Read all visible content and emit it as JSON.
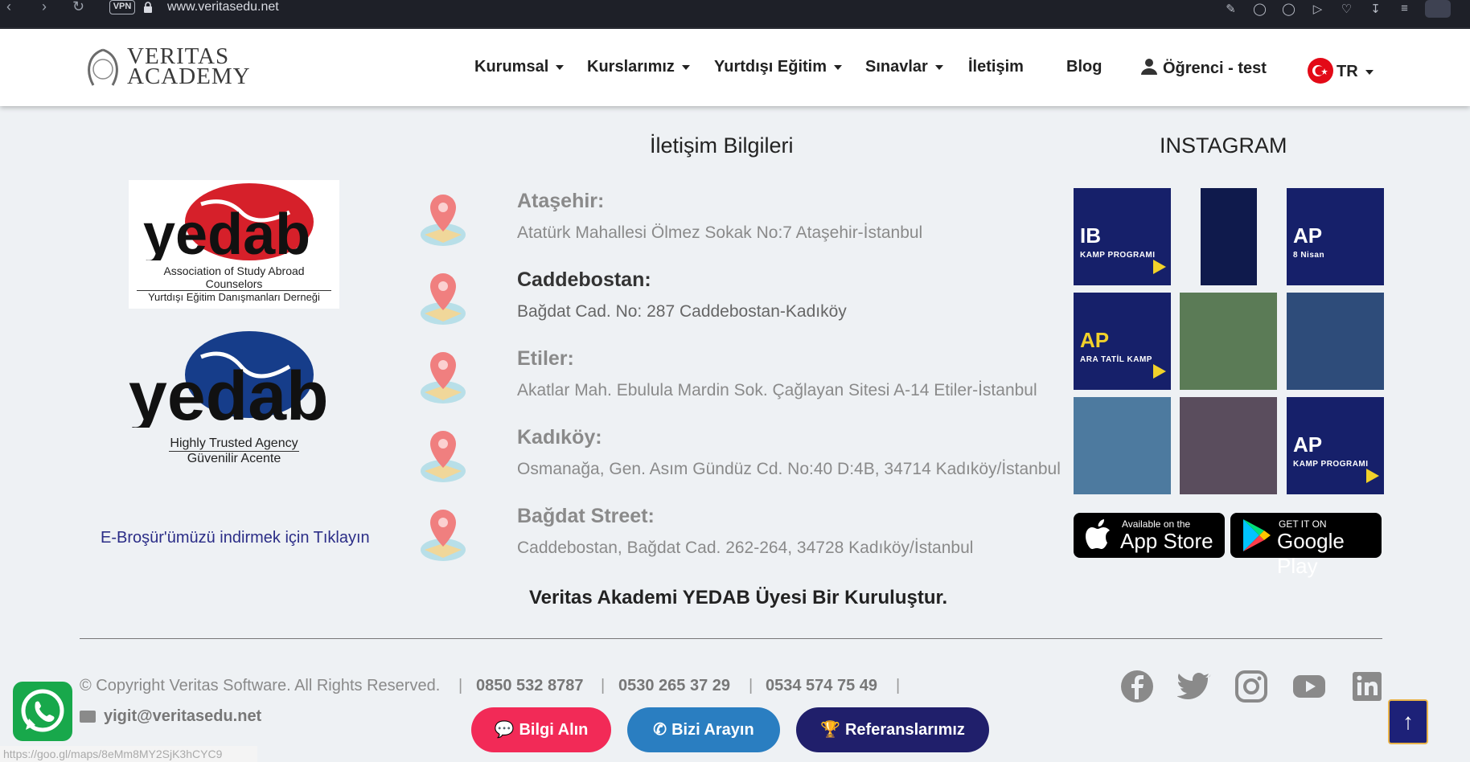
{
  "browser": {
    "url": "www.veritasedu.net",
    "vpn_label": "VPN"
  },
  "header": {
    "logo_line1": "VERITAS",
    "logo_line2": "ACADEMY",
    "nav": [
      {
        "label": "Kurumsal",
        "dropdown": true
      },
      {
        "label": "Kurslarımız",
        "dropdown": true
      },
      {
        "label": "Yurtdışı Eğitim",
        "dropdown": true
      },
      {
        "label": "Sınavlar",
        "dropdown": true
      },
      {
        "label": "İletişim",
        "dropdown": false
      },
      {
        "label": "Blog",
        "dropdown": false
      }
    ],
    "user_label": "Öğrenci - test",
    "language": "TR"
  },
  "yedab": {
    "badge1": {
      "word": "yedab",
      "line1": "Association of Study Abroad Counselors",
      "line2": "Yurtdışı Eğitim Danışmanları Derneği",
      "color": "#d6202a"
    },
    "badge2": {
      "word": "yedab",
      "line1": "Highly Trusted Agency",
      "line2": "Güvenilir Acente",
      "color": "#163d8a"
    },
    "brochure_link": "E-Broşür'ümüzü indirmek için Tıklayın"
  },
  "contact": {
    "title": "İletişim Bilgileri",
    "locations": [
      {
        "name": "Ataşehir:",
        "address": "Atatürk Mahallesi Ölmez Sokak No:7 Ataşehir-İstanbul"
      },
      {
        "name": "Caddebostan:",
        "address": "Bağdat Cad. No: 287 Caddebostan-Kadıköy"
      },
      {
        "name": "Etiler:",
        "address": "Akatlar Mah. Ebulula Mardin Sok. Çağlayan Sitesi A-14 Etiler-İstanbul"
      },
      {
        "name": "Kadıköy:",
        "address": "Osmanağa, Gen. Asım Gündüz Cd. No:40 D:4B, 34714 Kadıköy/İstanbul"
      },
      {
        "name": "Bağdat Street:",
        "address": "Caddebostan, Bağdat Cad. 262-264, 34728 Kadıköy/İstanbul"
      }
    ],
    "member_note": "Veritas Akademi YEDAB Üyesi Bir Kuruluştur."
  },
  "instagram": {
    "title": "INSTAGRAM",
    "tiles": [
      {
        "big": "IB",
        "small": "KAMP PROGRAMI",
        "style": "navy"
      },
      {
        "big": "",
        "small": "",
        "style": "dark"
      },
      {
        "big": "AP",
        "small": "8 Nisan",
        "style": "navy"
      },
      {
        "big": "AP",
        "small": "ARA TATİL KAMP",
        "style": "navy"
      },
      {
        "big": "",
        "small": "",
        "style": "photo"
      },
      {
        "big": "",
        "small": "",
        "style": "photo"
      },
      {
        "big": "",
        "small": "",
        "style": "photo"
      },
      {
        "big": "",
        "small": "",
        "style": "photo"
      },
      {
        "big": "AP",
        "small": "KAMP PROGRAMI",
        "style": "navy"
      }
    ],
    "app_store": {
      "top": "Available on the",
      "bottom": "App Store"
    },
    "google_play": {
      "top": "GET IT ON",
      "bottom": "Google Play"
    }
  },
  "footer": {
    "copyright": "© Copyright Veritas Software. All Rights Reserved.",
    "phones": [
      "0850 532 8787",
      "0530 265 37 29",
      "0534 574 75 49"
    ],
    "email": "yigit@veritasedu.net",
    "buttons": [
      {
        "label": "Bilgi Alın",
        "color": "#f22a57"
      },
      {
        "label": "Bizi Arayın",
        "color": "#2a7ec1"
      },
      {
        "label": "Referanslarımız",
        "color": "#201f6b"
      }
    ],
    "social": [
      "facebook-icon",
      "twitter-icon",
      "instagram-icon",
      "youtube-icon",
      "linkedin-icon"
    ]
  },
  "status_url": "https://goo.gl/maps/8eMm8MY2SjK3hCYC9"
}
